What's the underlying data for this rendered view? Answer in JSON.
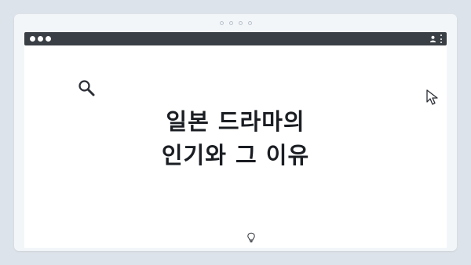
{
  "window": {
    "title_lines": [
      "일본 드라마의",
      "인기와 그 이유"
    ]
  },
  "colors": {
    "page_background": "#dde3ea",
    "window_background": "#f3f6f9",
    "browser_bar": "#3a3f45",
    "viewport": "#ffffff",
    "title_text": "#1a1d22"
  },
  "icons": {
    "search": "search-icon",
    "cursor": "cursor-icon",
    "bulb": "lightbulb-icon",
    "profile": "profile-icon",
    "menu": "kebab-menu-icon"
  }
}
